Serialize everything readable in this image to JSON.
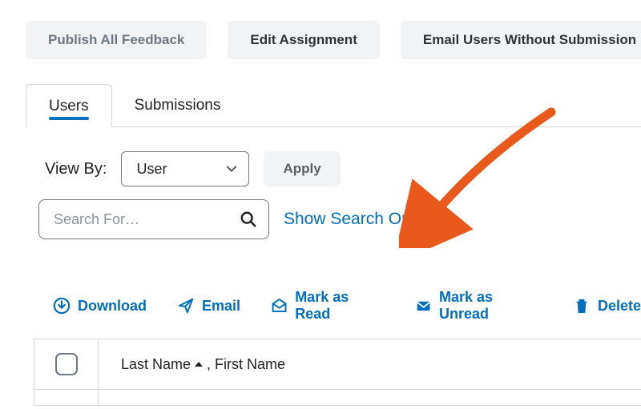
{
  "top_buttons": {
    "publish": "Publish All Feedback",
    "edit": "Edit Assignment",
    "email_no_sub": "Email Users Without Submission"
  },
  "tabs": {
    "users": "Users",
    "submissions": "Submissions"
  },
  "viewby": {
    "label": "View By:",
    "selected": "User",
    "apply": "Apply"
  },
  "search": {
    "placeholder": "Search For…",
    "options_link": "Show Search Options"
  },
  "toolbar": {
    "download": "Download",
    "email": "Email",
    "mark_read": "Mark as Read",
    "mark_unread": "Mark as Unread",
    "delete": "Delete"
  },
  "table": {
    "col_lastname": "Last Name",
    "col_firstname": ", First Name"
  }
}
